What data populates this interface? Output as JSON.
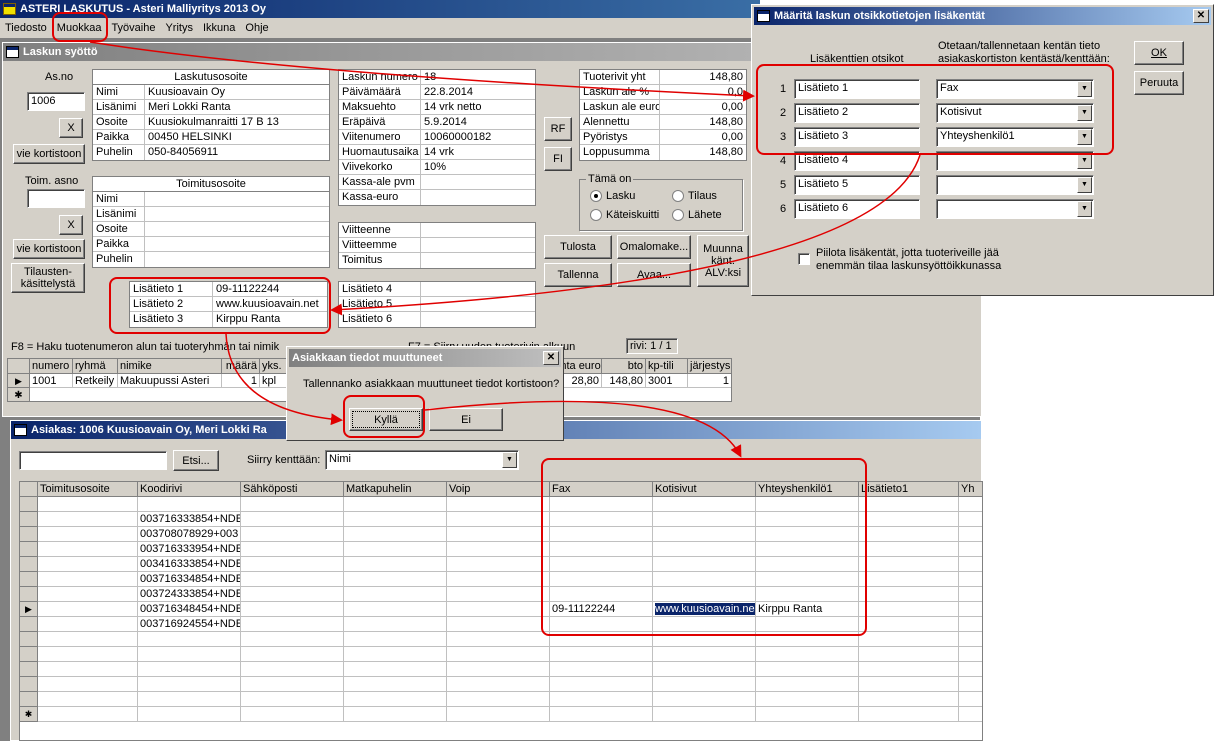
{
  "app": {
    "title": "ASTERI LASKUTUS - Asteri Malliyritys 2013 Oy",
    "menu": [
      "Tiedosto",
      "Muokkaa",
      "Työvaihe",
      "Yritys",
      "Ikkuna",
      "Ohje"
    ]
  },
  "invoice": {
    "window_title": "Laskun syöttö",
    "asno_label": "As.no",
    "asno_value": "1006",
    "x_button": "X",
    "vie_kortistoon": "vie kortistoon",
    "toim_asno_label": "Toim. asno",
    "tilausten_btn": "Tilausten-käsittelystä",
    "billing": {
      "header": "Laskutusosoite",
      "rows": [
        [
          "Nimi",
          "Kuusioavain Oy"
        ],
        [
          "Lisänimi",
          "Meri Lokki Ranta"
        ],
        [
          "Osoite",
          "Kuusiokulmanraitti 17 B 13"
        ],
        [
          "Paikka",
          "00450 HELSINKI"
        ],
        [
          "Puhelin",
          "050-84056911"
        ]
      ]
    },
    "delivery": {
      "header": "Toimitusosoite",
      "rows": [
        "Nimi",
        "Lisänimi",
        "Osoite",
        "Paikka",
        "Puhelin"
      ]
    },
    "extra": [
      [
        "Lisätieto 1",
        "09-11122244"
      ],
      [
        "Lisätieto 2",
        "www.kuusioavain.net"
      ],
      [
        "Lisätieto 3",
        "Kirppu Ranta"
      ]
    ],
    "info": [
      [
        "Laskun numero",
        "18"
      ],
      [
        "Päivämäärä",
        "22.8.2014"
      ],
      [
        "Maksuehto",
        "14 vrk netto"
      ],
      [
        "Eräpäivä",
        "5.9.2014"
      ],
      [
        "Viitenumero",
        "10060000182"
      ],
      [
        "Huomautusaika",
        "14 vrk"
      ],
      [
        "Viivekorko",
        "10%"
      ],
      [
        "Kassa-ale pvm",
        ""
      ],
      [
        "Kassa-euro",
        ""
      ]
    ],
    "refs": [
      "Viitteenne",
      "Viitteemme",
      "Toimitus"
    ],
    "extra2": [
      "Lisätieto 4",
      "Lisätieto 5",
      "Lisätieto 6"
    ],
    "totals": [
      [
        "Tuoterivit yht",
        "148,80"
      ],
      [
        "Laskun ale %",
        "0,0"
      ],
      [
        "Laskun ale euro",
        "0,00"
      ],
      [
        "Alennettu",
        "148,80"
      ],
      [
        "Pyöristys",
        "0,00"
      ],
      [
        "Loppusumma",
        "148,80"
      ]
    ],
    "rf": "RF",
    "fi": "FI",
    "tama_on": "Tämä on",
    "radios": [
      "Lasku",
      "Tilaus",
      "Käteiskuitti",
      "Lähete"
    ],
    "buttons": {
      "tulosta": "Tulosta",
      "omalomake": "Omalomake...",
      "tallenna": "Tallenna",
      "avaa": "Avaa...",
      "muunna": "Muunna känt. ALV:ksi"
    },
    "hint": "F8 = Haku tuotenumeron alun tai tuoteryhmän tai nimik",
    "hint2": "F7 = Siirry uuden tuoterivin alkuun",
    "rivi": "rivi: 1 / 1",
    "grid_cols": [
      "numero",
      "ryhmä",
      "nimike",
      "määrä",
      "yks.",
      "à-hinta euro",
      "bto",
      "kp-tili",
      "järjestys"
    ],
    "grid_row": [
      "1001",
      "Retkeily",
      "Makuupussi Asteri",
      "1",
      "kpl",
      "28,80",
      "148,80",
      "3001",
      "1"
    ]
  },
  "dialog_fields": {
    "title": "Määritä laskun otsikkotietojen lisäkentät",
    "col1": "Lisäkenttien otsikot",
    "col2": "Otetaan/tallennetaan kentän tieto asiakaskortiston kentästä/kenttään:",
    "rows": [
      [
        "1",
        "Lisätieto 1",
        "Fax"
      ],
      [
        "2",
        "Lisätieto 2",
        "Kotisivut"
      ],
      [
        "3",
        "Lisätieto 3",
        "Yhteyshenkilö1"
      ],
      [
        "4",
        "Lisätieto 4",
        ""
      ],
      [
        "5",
        "Lisätieto 5",
        ""
      ],
      [
        "6",
        "Lisätieto 6",
        ""
      ]
    ],
    "ok": "OK",
    "cancel": "Peruuta",
    "hide_label": "Piilota lisäkentät, jotta tuoteriveille jää enemmän tilaa laskunsyöttöikkunassa"
  },
  "confirm": {
    "title": "Asiakkaan tiedot muuttuneet",
    "message": "Tallennanko asiakkaan muuttuneet tiedot kortistoon?",
    "yes": "Kyllä",
    "no": "Ei"
  },
  "customer": {
    "title": "Asiakas: 1006  Kuusioavain Oy, Meri Lokki Ra",
    "search_btn": "Etsi...",
    "siirry_label": "Siirry kenttään:",
    "siirry_value": "Nimi",
    "cols": [
      "Toimitusosoite",
      "Koodirivi",
      "Sähköposti",
      "Matkapuhelin",
      "Voip",
      "Fax",
      "Kotisivut",
      "Yhteyshenkilö1",
      "Lisätieto1",
      "Yh"
    ],
    "rows": [
      [
        "",
        ""
      ],
      [
        "",
        "003716333854+NDE"
      ],
      [
        "",
        "003708078929+003"
      ],
      [
        "",
        "003716333954+NDE"
      ],
      [
        "",
        "003416333854+NDE"
      ],
      [
        "",
        "003716334854+NDE"
      ],
      [
        "",
        "003724333854+NDE"
      ],
      [
        "",
        "003716348454+NDE"
      ],
      [
        "",
        "003716924554+NDE"
      ]
    ],
    "sel": {
      "fax": "09-11122244",
      "kotisivut": "www.kuusioavain.ne",
      "yhteys": "Kirppu Ranta"
    }
  }
}
